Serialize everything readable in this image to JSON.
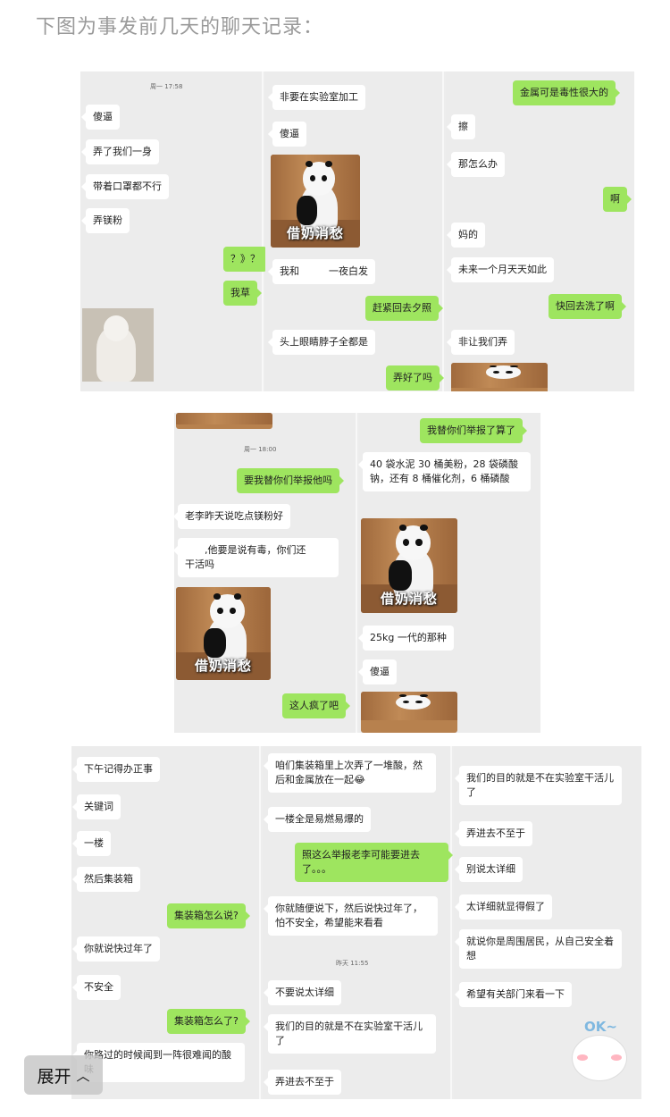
{
  "intro": "下图为事发前几天的聊天记录：",
  "expand": {
    "label": "展开",
    "icon": "chevron-up-icon"
  },
  "sticker_caption": "借奶消愁",
  "shot1": {
    "col1": {
      "timestamp": "周一 17:58",
      "messages": [
        {
          "text": "傻逼",
          "side": "in"
        },
        {
          "text": "弄了我们一身",
          "side": "in"
        },
        {
          "text": "带着口罩都不行",
          "side": "in"
        },
        {
          "text": "弄镁粉",
          "side": "in"
        },
        {
          "text": "？》？",
          "side": "out"
        },
        {
          "text": "我草",
          "side": "out"
        }
      ]
    },
    "col2": {
      "messages": [
        {
          "text": "非要在实验室加工",
          "side": "in"
        },
        {
          "text": "傻逼",
          "side": "in"
        },
        {
          "text": "我和　　　一夜白发",
          "side": "in"
        },
        {
          "text": "赶紧回去夕照",
          "side": "out"
        },
        {
          "text": "头上眼睛脖子全都是",
          "side": "in"
        },
        {
          "text": "弄好了吗",
          "side": "out"
        }
      ]
    },
    "col3": {
      "messages": [
        {
          "text": "金属可是毒性很大的",
          "side": "out"
        },
        {
          "text": "擦",
          "side": "in"
        },
        {
          "text": "那怎么办",
          "side": "in"
        },
        {
          "text": "啊",
          "side": "out"
        },
        {
          "text": "妈的",
          "side": "in"
        },
        {
          "text": "未来一个月天天如此",
          "side": "in"
        },
        {
          "text": "快回去洗了啊",
          "side": "out"
        },
        {
          "text": "非让我们弄",
          "side": "in"
        }
      ]
    }
  },
  "shot2": {
    "col1": {
      "timestamp": "周一 18:00",
      "messages": [
        {
          "text": "要我替你们举报他吗",
          "side": "out"
        },
        {
          "text": "老李昨天说吃点镁粉好",
          "side": "in"
        },
        {
          "text": "　　,他要是说有毒，你们还　　干活吗",
          "side": "in"
        },
        {
          "text": "这人疯了吧",
          "side": "out"
        }
      ]
    },
    "col2": {
      "messages": [
        {
          "text": "我替你们举报了算了",
          "side": "out"
        },
        {
          "text": "40 袋水泥 30 桶美粉，28 袋磷酸钠，还有 8 桶催化剂，6 桶磷酸",
          "side": "in"
        },
        {
          "text": "25kg 一代的那种",
          "side": "in"
        },
        {
          "text": "傻逼",
          "side": "in"
        }
      ]
    }
  },
  "shot3": {
    "col1": {
      "messages": [
        {
          "text": "下午记得办正事",
          "side": "in"
        },
        {
          "text": "关键词",
          "side": "in"
        },
        {
          "text": "一楼",
          "side": "in"
        },
        {
          "text": "然后集装箱",
          "side": "in"
        },
        {
          "text": "集装箱怎么说?",
          "side": "out"
        },
        {
          "text": "你就说快过年了",
          "side": "in"
        },
        {
          "text": "不安全",
          "side": "in"
        },
        {
          "text": "集装箱怎么了?",
          "side": "out"
        },
        {
          "text": "你路过的时候闻到一阵很难闻的酸味",
          "side": "in"
        }
      ]
    },
    "col2": {
      "timestamp": "昨天 11:55",
      "messages": [
        {
          "text": "咱们集装箱里上次弄了一堆酸，然后和金属放在一起😂",
          "side": "in"
        },
        {
          "text": "一楼全是易燃易爆的",
          "side": "in"
        },
        {
          "text": "照这么举报老李可能要进去了。。。",
          "side": "out"
        },
        {
          "text": "你就随便说下，然后说快过年了，怕不安全，希望能来看看",
          "side": "in"
        },
        {
          "text": "不要说太详细",
          "side": "in"
        },
        {
          "text": "我们的目的就是不在实验室干活儿了",
          "side": "in"
        },
        {
          "text": "弄进去不至于",
          "side": "in"
        }
      ]
    },
    "col3": {
      "messages": [
        {
          "text": "我们的目的就是不在实验室干活儿了",
          "side": "in"
        },
        {
          "text": "弄进去不至于",
          "side": "in"
        },
        {
          "text": "别说太详细",
          "side": "in"
        },
        {
          "text": "太详细就显得假了",
          "side": "in"
        },
        {
          "text": "就说你是周围居民，从自己安全着想",
          "side": "in"
        },
        {
          "text": "希望有关部门来看一下",
          "side": "in"
        }
      ],
      "sticker_text": "OK~"
    }
  }
}
